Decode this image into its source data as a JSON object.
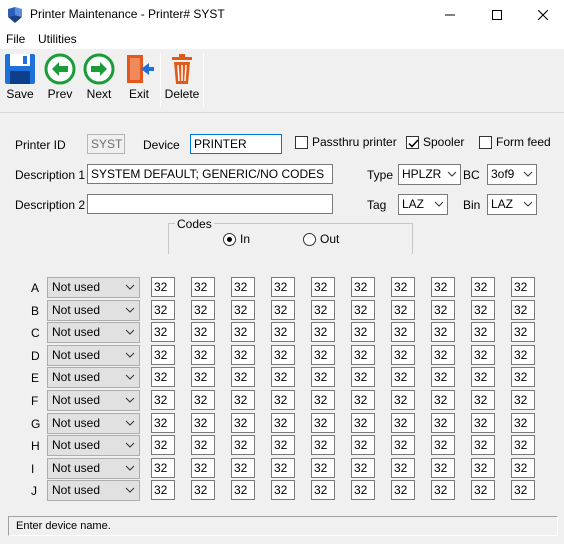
{
  "window": {
    "title": "Printer Maintenance - Printer# SYST"
  },
  "menu": {
    "items": [
      "File",
      "Utilities"
    ]
  },
  "toolbar": {
    "save_label": "Save",
    "prev_label": "Prev",
    "next_label": "Next",
    "exit_label": "Exit",
    "delete_label": "Delete"
  },
  "form": {
    "printer_id_label": "Printer ID",
    "printer_id_value": "SYST",
    "device_label": "Device",
    "device_value": "PRINTER",
    "passthru_label": "Passthru printer",
    "passthru_checked": false,
    "spooler_label": "Spooler",
    "spooler_checked": true,
    "formfeed_label": "Form feed",
    "formfeed_checked": false,
    "desc1_label": "Description 1",
    "desc1_value": "SYSTEM DEFAULT; GENERIC/NO CODES",
    "desc2_label": "Description 2",
    "desc2_value": "",
    "type_label": "Type",
    "type_value": "HPLZR",
    "bc_label": "BC",
    "bc_value": "3of9",
    "tag_label": "Tag",
    "tag_value": "LAZ",
    "bin_label": "Bin",
    "bin_value": "LAZ",
    "codes_group_label": "Codes",
    "codes_in_label": "In",
    "codes_out_label": "Out",
    "codes_selected": "In"
  },
  "codes": {
    "rows": [
      {
        "letter": "A",
        "option": "Not used",
        "values": [
          "32",
          "32",
          "32",
          "32",
          "32",
          "32",
          "32",
          "32",
          "32",
          "32"
        ]
      },
      {
        "letter": "B",
        "option": "Not used",
        "values": [
          "32",
          "32",
          "32",
          "32",
          "32",
          "32",
          "32",
          "32",
          "32",
          "32"
        ]
      },
      {
        "letter": "C",
        "option": "Not used",
        "values": [
          "32",
          "32",
          "32",
          "32",
          "32",
          "32",
          "32",
          "32",
          "32",
          "32"
        ]
      },
      {
        "letter": "D",
        "option": "Not used",
        "values": [
          "32",
          "32",
          "32",
          "32",
          "32",
          "32",
          "32",
          "32",
          "32",
          "32"
        ]
      },
      {
        "letter": "E",
        "option": "Not used",
        "values": [
          "32",
          "32",
          "32",
          "32",
          "32",
          "32",
          "32",
          "32",
          "32",
          "32"
        ]
      },
      {
        "letter": "F",
        "option": "Not used",
        "values": [
          "32",
          "32",
          "32",
          "32",
          "32",
          "32",
          "32",
          "32",
          "32",
          "32"
        ]
      },
      {
        "letter": "G",
        "option": "Not used",
        "values": [
          "32",
          "32",
          "32",
          "32",
          "32",
          "32",
          "32",
          "32",
          "32",
          "32"
        ]
      },
      {
        "letter": "H",
        "option": "Not used",
        "values": [
          "32",
          "32",
          "32",
          "32",
          "32",
          "32",
          "32",
          "32",
          "32",
          "32"
        ]
      },
      {
        "letter": "I",
        "option": "Not used",
        "values": [
          "32",
          "32",
          "32",
          "32",
          "32",
          "32",
          "32",
          "32",
          "32",
          "32"
        ]
      },
      {
        "letter": "J",
        "option": "Not used",
        "values": [
          "32",
          "32",
          "32",
          "32",
          "32",
          "32",
          "32",
          "32",
          "32",
          "32"
        ]
      }
    ]
  },
  "status": {
    "text": "Enter device name."
  },
  "icons": {
    "app": "printer-app-icon",
    "save": "floppy-disk-icon",
    "prev": "arrow-left-icon",
    "next": "arrow-right-icon",
    "exit": "exit-door-icon",
    "delete": "trash-can-icon"
  },
  "colors": {
    "accent": "#0078d7",
    "save_icon": "#1e6fd9",
    "nav_icon": "#1a9c3a",
    "exit_icon": "#e2571e",
    "delete_icon": "#e05a1a"
  }
}
